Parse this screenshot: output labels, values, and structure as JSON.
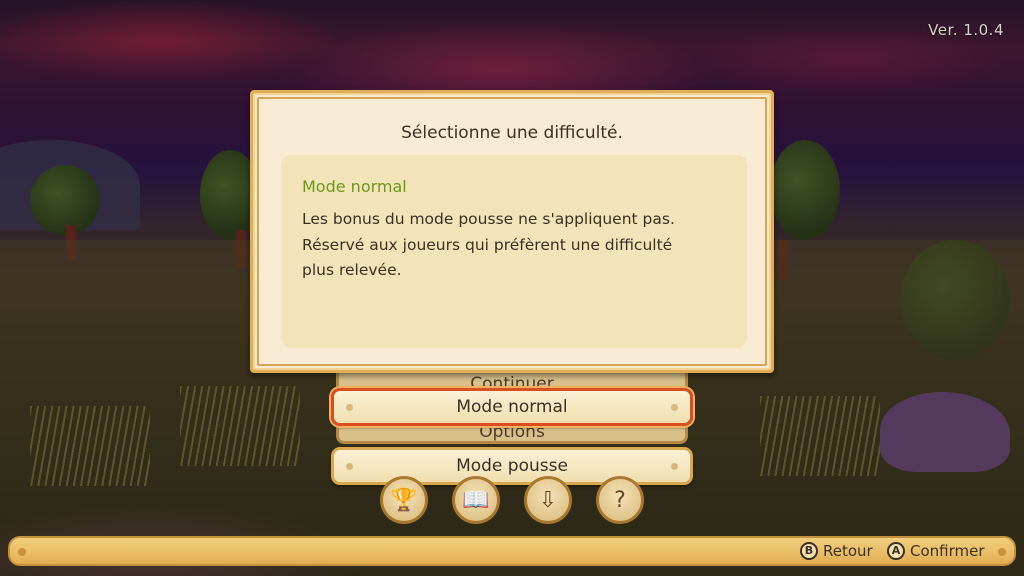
{
  "version": "Ver. 1.0.4",
  "background_menu": {
    "items": [
      "Continuer",
      "Options"
    ]
  },
  "dialog": {
    "title": "Sélectionne une difficulté.",
    "selected_mode_name": "Mode normal",
    "selected_mode_description": "Les bonus du mode pousse ne s'appliquent pas. Réservé aux joueurs qui préfèrent une difficulté plus relevée.",
    "accent_color": "#6b9a18"
  },
  "options": [
    {
      "label": "Mode normal",
      "selected": true
    },
    {
      "label": "Mode pousse",
      "selected": false
    }
  ],
  "icon_buttons": [
    {
      "icon": "trophy-icon",
      "glyph": "🏆"
    },
    {
      "icon": "book-icon",
      "glyph": "📖"
    },
    {
      "icon": "download-icon",
      "glyph": "⇩"
    },
    {
      "icon": "help-search-icon",
      "glyph": "?"
    }
  ],
  "controls": {
    "back": {
      "button": "B",
      "label": "Retour"
    },
    "confirm": {
      "button": "A",
      "label": "Confirmer"
    }
  },
  "colors": {
    "selection_border": "#d8501f",
    "bar": "#e2ae52"
  }
}
